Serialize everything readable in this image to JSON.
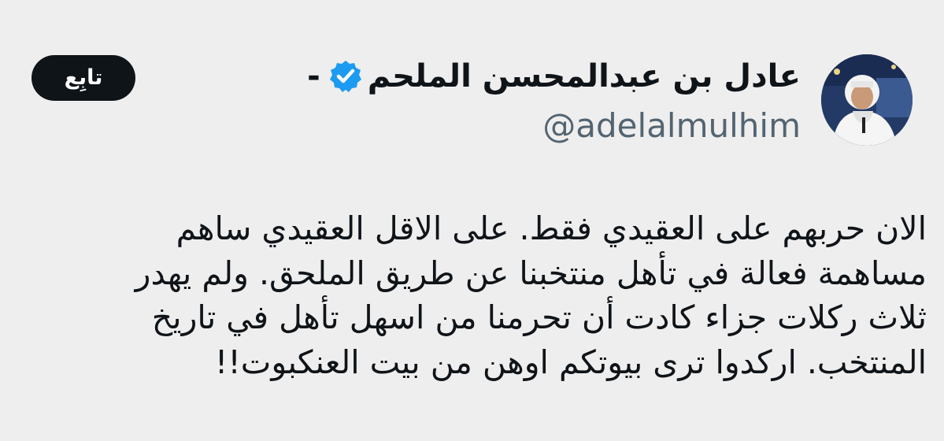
{
  "author": {
    "display_name": "عادل بن عبدالمحسن الملحم",
    "name_suffix": "-",
    "handle": "@adelalmulhim",
    "verified": true,
    "avatar_icon": "profile-photo",
    "verified_icon": "verified-badge-icon"
  },
  "follow_button": {
    "label": "تابِع"
  },
  "tweet": {
    "lines": [
      "الان حربهم على العقيدي فقط. على الاقل العقيدي ساهم",
      "مساهمة فعالة في تأهل منتخبنا عن طريق الملحق. ولم يهدر",
      "ثلاث ركلات جزاء كادت أن تحرمنا من اسهل تأهل في تاريخ",
      "المنتخب. اركدوا ترى بيوتكم اوهن من بيت العنكبوت!!"
    ]
  },
  "colors": {
    "background": "#efeeee",
    "text": "#0f1419",
    "secondary_text": "#536471",
    "verified_blue": "#1d9bf0",
    "button_bg": "#0f1419",
    "button_text": "#ffffff"
  }
}
